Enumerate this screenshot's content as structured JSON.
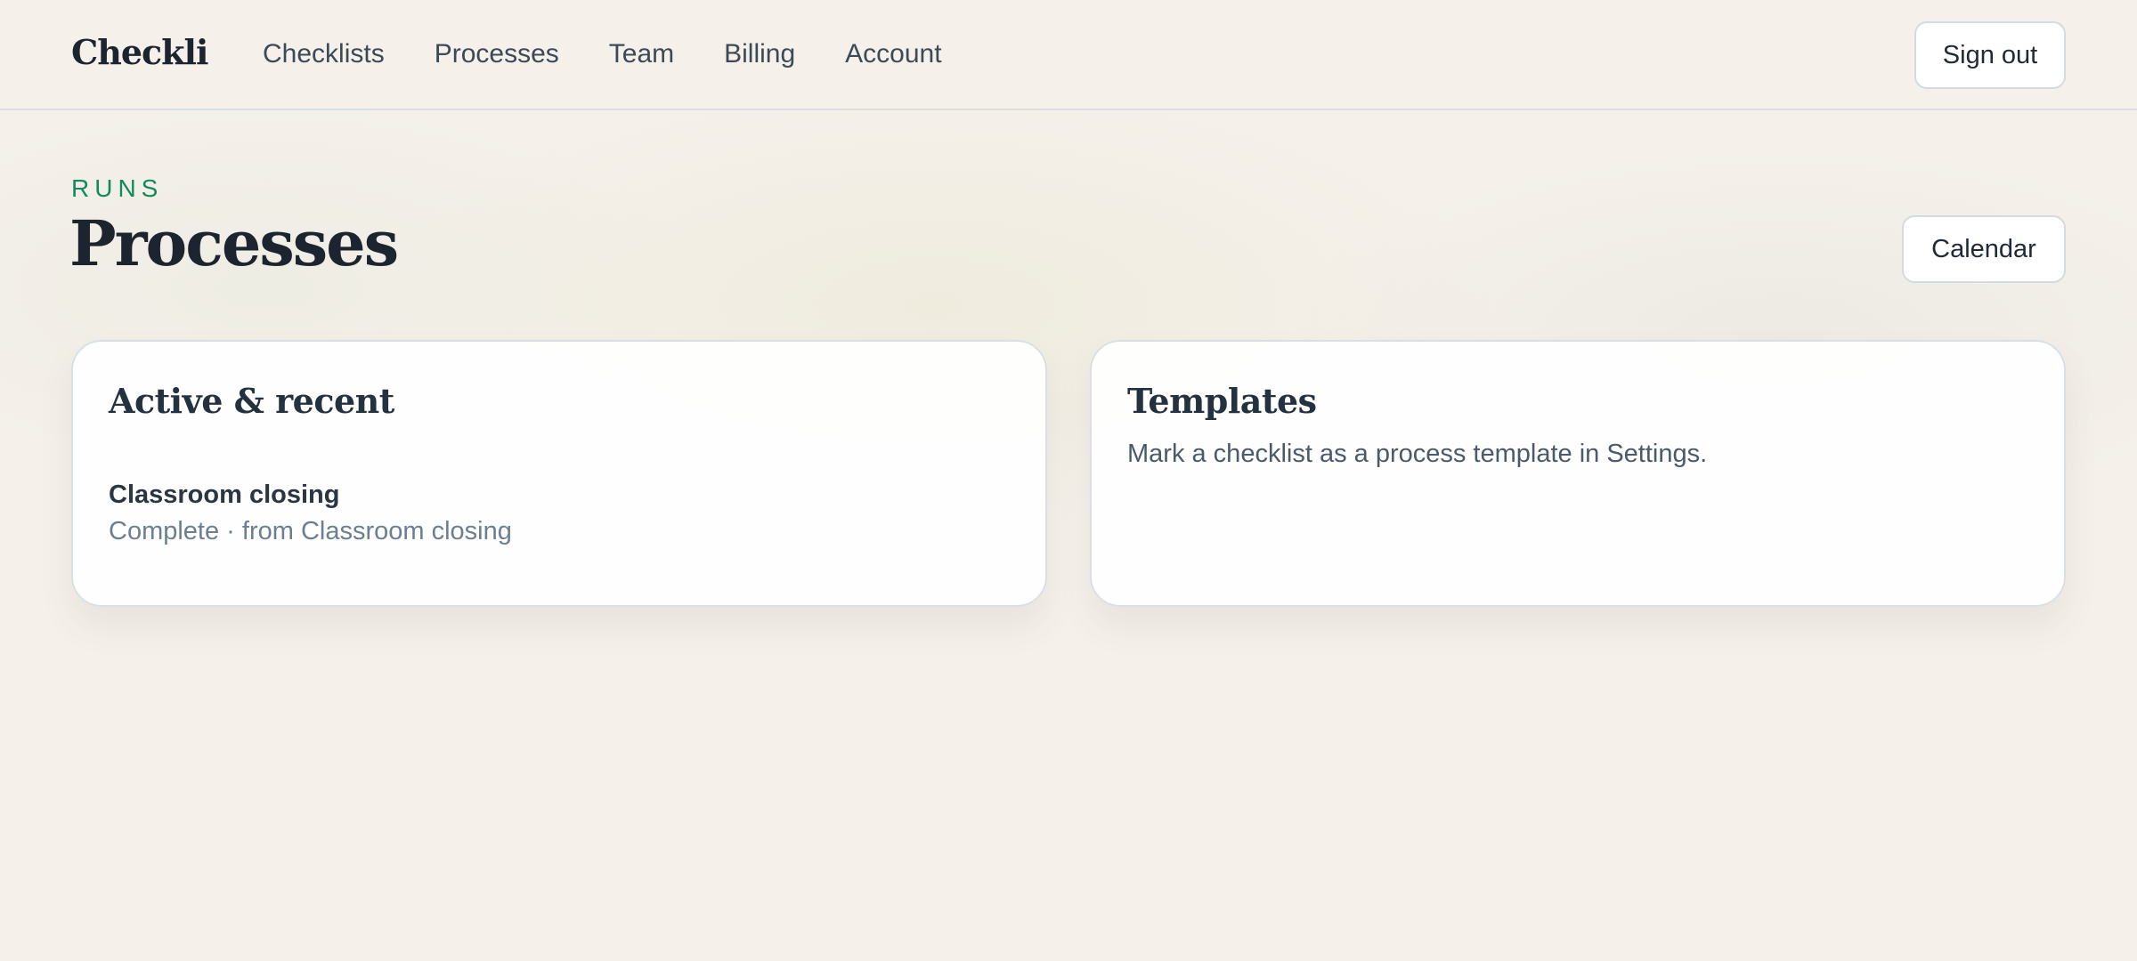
{
  "brand": "Checkli",
  "nav": {
    "items": [
      {
        "label": "Checklists"
      },
      {
        "label": "Processes"
      },
      {
        "label": "Team"
      },
      {
        "label": "Billing"
      },
      {
        "label": "Account"
      }
    ],
    "sign_out_label": "Sign out"
  },
  "header": {
    "eyebrow": "RUNS",
    "title": "Processes",
    "calendar_label": "Calendar"
  },
  "cards": {
    "active": {
      "title": "Active & recent",
      "items": [
        {
          "title": "Classroom closing",
          "meta": "Complete · from Classroom closing"
        }
      ]
    },
    "templates": {
      "title": "Templates",
      "text": "Mark a checklist as a process template in Settings."
    }
  },
  "colors": {
    "accent": "#118a5e",
    "background": "#f5f0ea",
    "text": "#1c2430"
  }
}
